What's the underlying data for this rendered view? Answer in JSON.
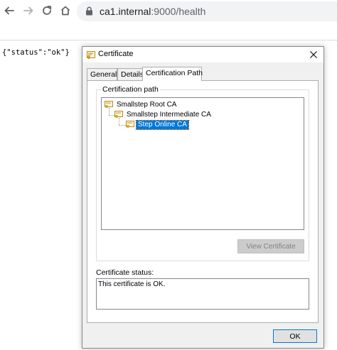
{
  "browser": {
    "url_host": "ca1.internal",
    "url_rest": ":9000/health",
    "icons": {
      "back": "arrow-left-icon",
      "forward": "arrow-right-icon",
      "reload": "reload-icon",
      "home": "home-icon",
      "lock": "lock-icon"
    }
  },
  "page": {
    "body_text": "{\"status\":\"ok\"}"
  },
  "dialog": {
    "title": "Certificate",
    "close_icon": "close-icon",
    "tabs": [
      {
        "label": "General",
        "active": false
      },
      {
        "label": "Details",
        "active": false
      },
      {
        "label": "Certification Path",
        "active": true
      }
    ],
    "path_group_label": "Certification path",
    "path": [
      {
        "label": "Smallstep Root CA",
        "selected": false
      },
      {
        "label": "Smallstep Intermediate CA",
        "selected": false
      },
      {
        "label": "Step Online CA",
        "selected": true
      }
    ],
    "view_certificate_label": "View Certificate",
    "status_label": "Certificate status:",
    "status_text": "This certificate is OK.",
    "ok_label": "OK"
  },
  "colors": {
    "selection": "#0078d7",
    "dialog_bg": "#f0f0f0",
    "omnibox_bg": "#f1f3f4"
  }
}
